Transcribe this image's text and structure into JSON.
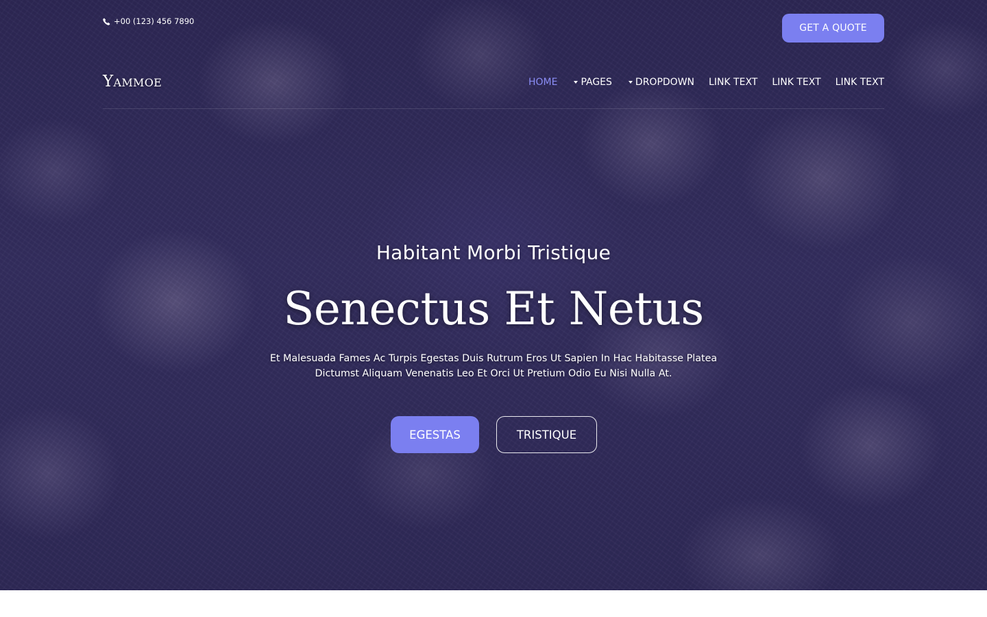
{
  "topbar": {
    "phone_icon": "phone-icon",
    "phone": "+00 (123) 456 7890",
    "quote_button": "GET A QUOTE"
  },
  "header": {
    "logo": "Yammoe",
    "nav": [
      {
        "label": "HOME",
        "active": true
      },
      {
        "label": "PAGES",
        "dropdown": true
      },
      {
        "label": "DROPDOWN",
        "dropdown": true
      },
      {
        "label": "LINK TEXT"
      },
      {
        "label": "LINK TEXT"
      },
      {
        "label": "LINK TEXT"
      }
    ]
  },
  "hero": {
    "subtitle": "Habitant Morbi Tristique",
    "headline": "Senectus Et Netus",
    "description_line1": "Et Malesuada Fames Ac Turpis Egestas Duis Rutrum Eros Ut Sapien In Hac Habitasse Platea",
    "description_line2": "Dictumst Aliquam Venenatis Leo Et Orci Ut Pretium Odio Eu Nisi Nulla At.",
    "primary_button": "EGESTAS",
    "secondary_button": "TRISTIQUE"
  },
  "colors": {
    "accent": "#7b7ff0",
    "active_nav": "#8a8df5",
    "hero_tint": "#2f2a52"
  }
}
